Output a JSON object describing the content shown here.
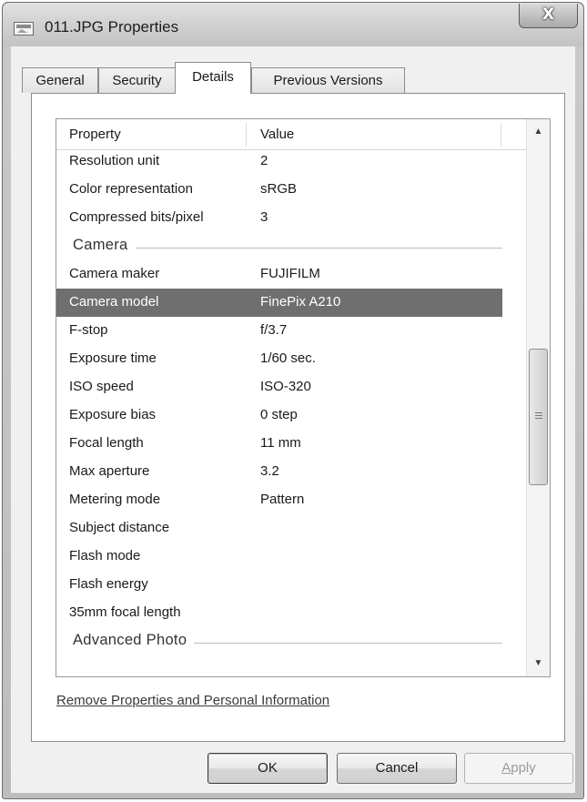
{
  "window": {
    "title": "011.JPG Properties",
    "close_glyph": "X"
  },
  "tabs": [
    {
      "label": "General",
      "active": false
    },
    {
      "label": "Security",
      "active": false
    },
    {
      "label": "Details",
      "active": true
    },
    {
      "label": "Previous Versions",
      "active": false
    }
  ],
  "details": {
    "columns": {
      "property": "Property",
      "value": "Value"
    },
    "rows": [
      {
        "kind": "row",
        "property": "Resolution unit",
        "value": "2"
      },
      {
        "kind": "row",
        "property": "Color representation",
        "value": "sRGB"
      },
      {
        "kind": "row",
        "property": "Compressed bits/pixel",
        "value": "3"
      },
      {
        "kind": "group",
        "label": "Camera"
      },
      {
        "kind": "row",
        "property": "Camera maker",
        "value": "FUJIFILM"
      },
      {
        "kind": "row",
        "property": "Camera model",
        "value": "FinePix A210",
        "selected": true
      },
      {
        "kind": "row",
        "property": "F-stop",
        "value": "f/3.7"
      },
      {
        "kind": "row",
        "property": "Exposure time",
        "value": "1/60 sec."
      },
      {
        "kind": "row",
        "property": "ISO speed",
        "value": "ISO-320"
      },
      {
        "kind": "row",
        "property": "Exposure bias",
        "value": "0 step"
      },
      {
        "kind": "row",
        "property": "Focal length",
        "value": "11 mm"
      },
      {
        "kind": "row",
        "property": "Max aperture",
        "value": "3.2"
      },
      {
        "kind": "row",
        "property": "Metering mode",
        "value": "Pattern"
      },
      {
        "kind": "row",
        "property": "Subject distance",
        "value": ""
      },
      {
        "kind": "row",
        "property": "Flash mode",
        "value": ""
      },
      {
        "kind": "row",
        "property": "Flash energy",
        "value": ""
      },
      {
        "kind": "row",
        "property": "35mm focal length",
        "value": ""
      },
      {
        "kind": "group",
        "label": "Advanced Photo"
      }
    ],
    "scroll_up_icon": "triangle-up",
    "scroll_down_icon": "triangle-down"
  },
  "remove_link": "Remove Properties and Personal Information",
  "buttons": {
    "ok": "OK",
    "cancel": "Cancel",
    "apply_accel": "A",
    "apply_rest": "pply"
  }
}
